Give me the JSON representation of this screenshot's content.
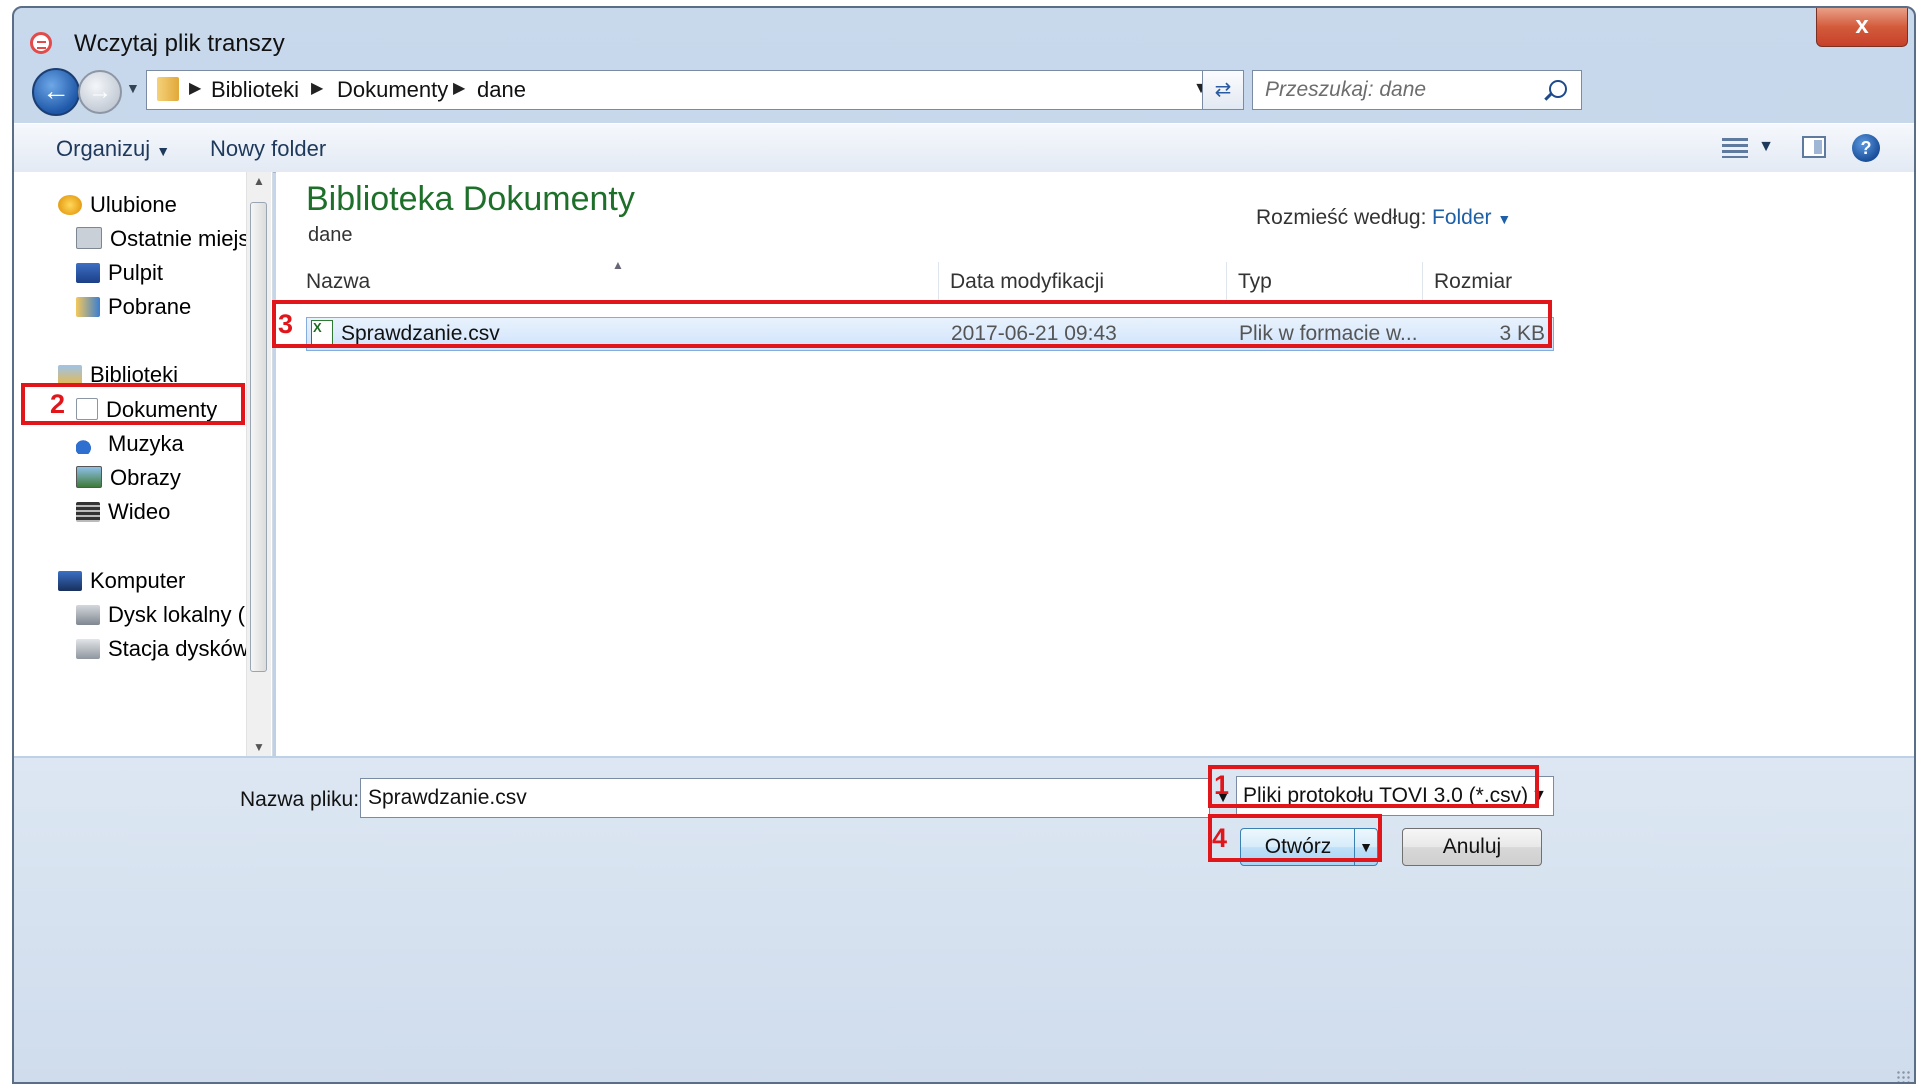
{
  "window": {
    "title": "Wczytaj plik transzy",
    "close_label": "x"
  },
  "address": {
    "crumbs": [
      "Biblioteki",
      "Dokumenty",
      "dane"
    ],
    "search_placeholder": "Przeszukaj: dane"
  },
  "toolbar": {
    "organize": "Organizuj",
    "new_folder": "Nowy folder"
  },
  "nav": {
    "favorites": "Ulubione",
    "recent": "Ostatnie miejsca",
    "desktop": "Pulpit",
    "downloads": "Pobrane",
    "libraries": "Biblioteki",
    "documents": "Dokumenty",
    "music": "Muzyka",
    "pictures": "Obrazy",
    "video": "Wideo",
    "computer": "Komputer",
    "local_disk": "Dysk lokalny (C:",
    "dvd_drive": "Stacja dysków C"
  },
  "content": {
    "library_title": "Biblioteka Dokumenty",
    "library_subtitle": "dane",
    "arrange_label": "Rozmieść według:",
    "arrange_value": "Folder",
    "columns": {
      "name": "Nazwa",
      "date": "Data modyfikacji",
      "type": "Typ",
      "size": "Rozmiar"
    },
    "files": [
      {
        "name": "Sprawdzanie.csv",
        "date": "2017-06-21 09:43",
        "type": "Plik w formacie w...",
        "size": "3 KB"
      }
    ]
  },
  "bottom": {
    "filename_label": "Nazwa pliku:",
    "filename_value": "Sprawdzanie.csv",
    "filetype": "Pliki protokołu TOVI 3.0 (*.csv)",
    "open_label": "Otwórz",
    "cancel_label": "Anuluj"
  },
  "callouts": [
    "1",
    "2",
    "3",
    "4"
  ],
  "colors": {
    "accent": "#1e6f2a",
    "callout": "#e0161b",
    "link": "#1d5fa8"
  }
}
